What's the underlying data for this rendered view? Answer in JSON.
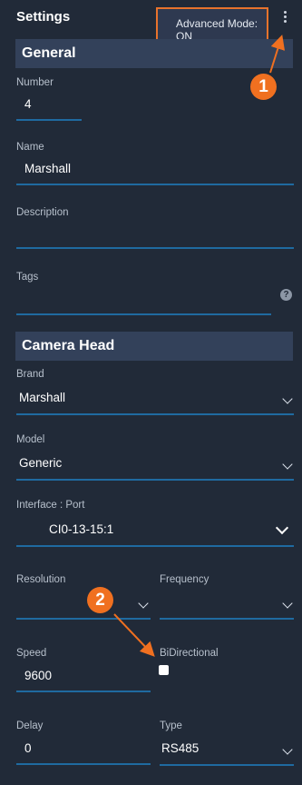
{
  "header": {
    "title": "Settings",
    "tooltip_line1": "Advanced Mode:",
    "tooltip_line2": "ON"
  },
  "sections": {
    "general": "General",
    "camera_head": "Camera Head"
  },
  "fields": {
    "number": {
      "label": "Number",
      "value": "4"
    },
    "name": {
      "label": "Name",
      "value": "Marshall"
    },
    "description": {
      "label": "Description",
      "value": ""
    },
    "tags": {
      "label": "Tags",
      "value": "",
      "help": "?"
    },
    "brand": {
      "label": "Brand",
      "value": "Marshall"
    },
    "model": {
      "label": "Model",
      "value": "Generic"
    },
    "interface_port": {
      "label": "Interface : Port",
      "value": "CI0-13-15:1"
    },
    "resolution": {
      "label": "Resolution",
      "value": ""
    },
    "frequency": {
      "label": "Frequency",
      "value": ""
    },
    "speed": {
      "label": "Speed",
      "value": "9600"
    },
    "bidirectional": {
      "label": "BiDirectional",
      "checked": false
    },
    "delay": {
      "label": "Delay",
      "value": "0"
    },
    "type": {
      "label": "Type",
      "value": "RS485"
    }
  },
  "annotations": {
    "badge1": "1",
    "badge2": "2"
  },
  "colors": {
    "background": "#212a38",
    "section": "#33415a",
    "underline": "#1f6aa0",
    "annotation": "#f07020"
  },
  "icons": [
    "kebab-menu-icon",
    "help-icon",
    "chevron-down-icon"
  ]
}
